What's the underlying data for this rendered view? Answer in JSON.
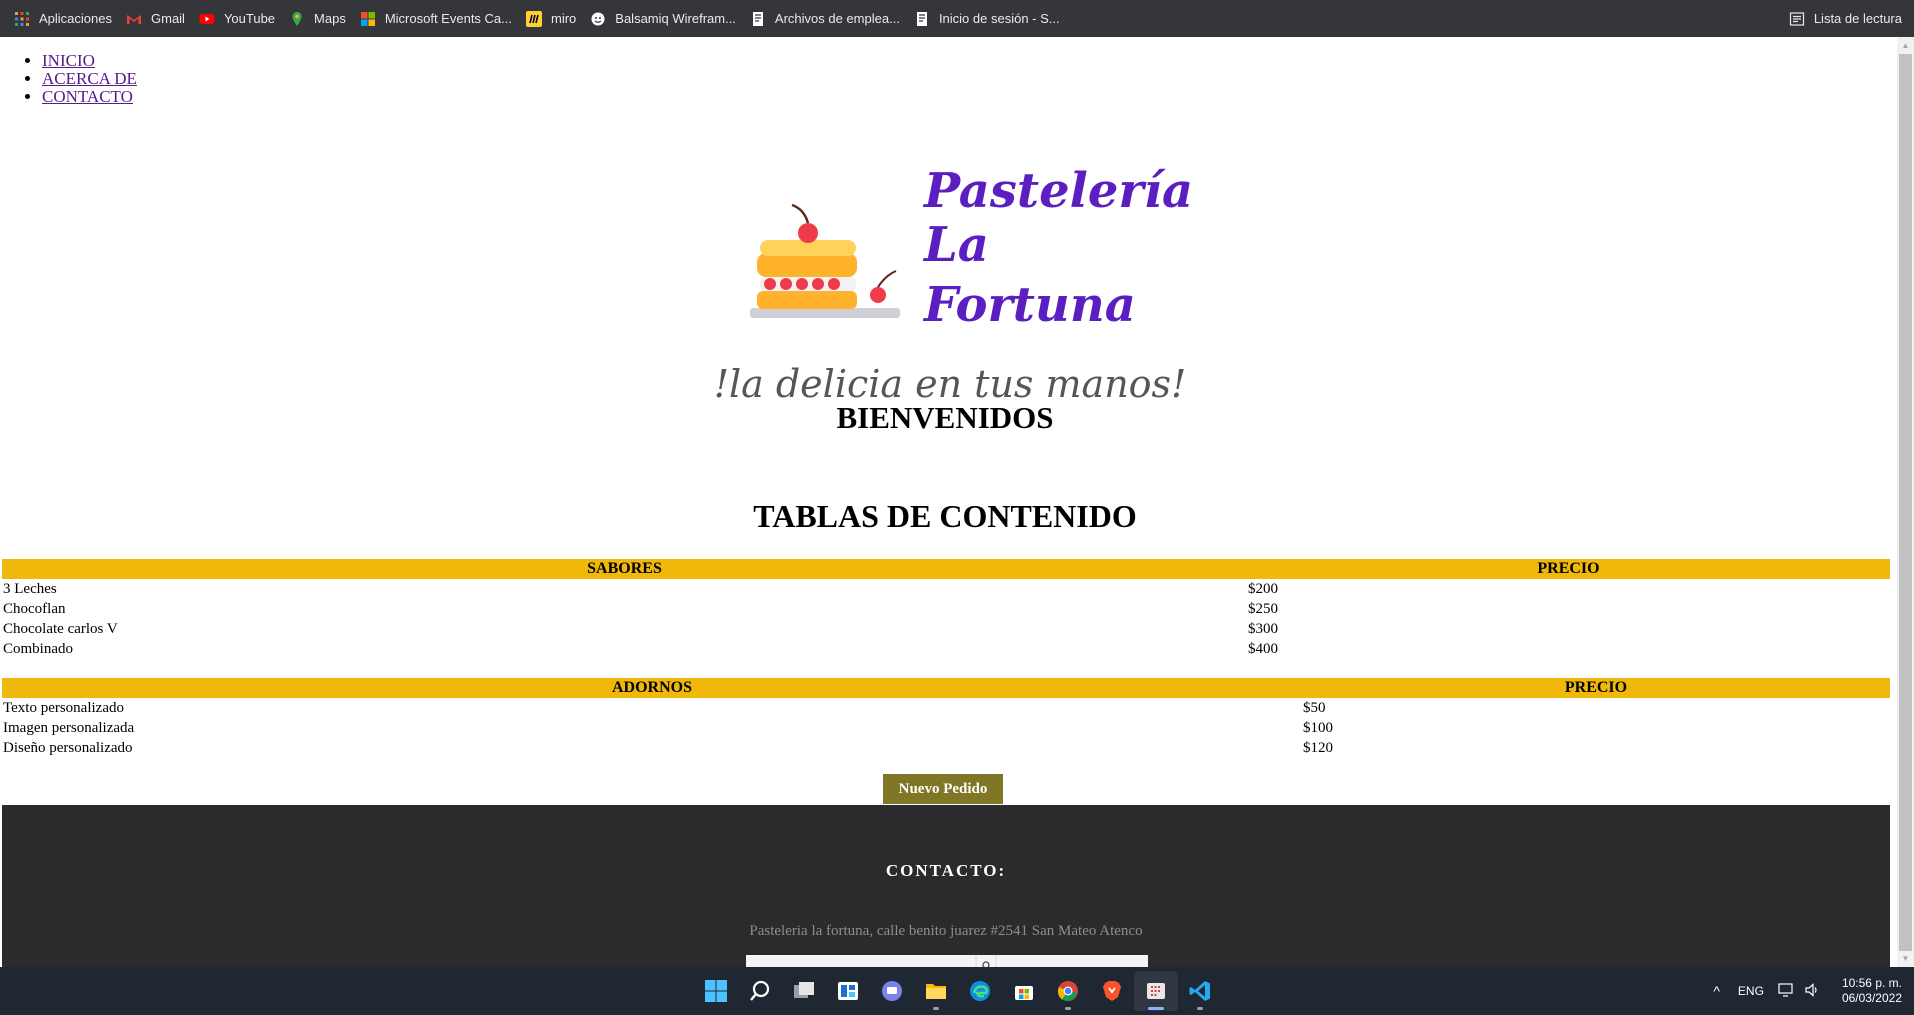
{
  "bookmarks": [
    {
      "label": "Aplicaciones",
      "icon": "apps-grid-icon",
      "color": "#e8a33a"
    },
    {
      "label": "Gmail",
      "icon": "gmail-icon",
      "color": "#ea4335"
    },
    {
      "label": "YouTube",
      "icon": "youtube-icon",
      "color": "#ff0000"
    },
    {
      "label": "Maps",
      "icon": "maps-pin-icon",
      "color": "#34a853"
    },
    {
      "label": "Microsoft Events Ca...",
      "icon": "microsoft-logo-icon",
      "color": "#f25022"
    },
    {
      "label": "miro",
      "icon": "miro-icon",
      "color": "#ffd02f"
    },
    {
      "label": "Balsamiq Wirefram...",
      "icon": "balsamiq-icon",
      "color": "#ffffff"
    },
    {
      "label": "Archivos de emplea...",
      "icon": "document-icon",
      "color": "#ffffff"
    },
    {
      "label": "Inicio de sesión - S...",
      "icon": "document-icon",
      "color": "#ffffff"
    }
  ],
  "reading_list": "Lista de lectura",
  "nav": [
    "INICIO",
    "ACERCA DE",
    "CONTACTO"
  ],
  "logo": {
    "line1": "Pastelería",
    "line2": "La",
    "line3": "Fortuna",
    "tagline": "!la delicia en tus manos!",
    "brand_color": "#5b1fc1"
  },
  "welcome": "BIENVENIDOS",
  "tables_title": "TABLAS DE CONTENIDO",
  "table_flavors": {
    "headers": [
      "SABORES",
      "PRECIO"
    ],
    "rows": [
      [
        "3 Leches",
        "$200"
      ],
      [
        "Chocoflan",
        "$250"
      ],
      [
        "Chocolate carlos V",
        "$300"
      ],
      [
        "Combinado",
        "$400"
      ]
    ]
  },
  "table_toppings": {
    "headers": [
      "ADORNOS",
      "PRECIO"
    ],
    "rows": [
      [
        "Texto personalizado",
        "$50"
      ],
      [
        "Imagen personalizada",
        "$100"
      ],
      [
        "Diseño personalizado",
        "$120"
      ]
    ]
  },
  "order_button": "Nuevo Pedido",
  "footer": {
    "title": "CONTACTO:",
    "address": "Pasteleria la fortuna, calle benito juarez #2541 San Mateo Atenco"
  },
  "taskbar": {
    "apps": [
      "windows-start-icon",
      "search-icon",
      "task-view-icon",
      "widgets-icon",
      "teams-chat-icon",
      "file-explorer-icon",
      "edge-icon",
      "store-icon",
      "chrome-icon",
      "brave-icon",
      "snipping-tool-icon",
      "vscode-icon"
    ],
    "language": "ENG",
    "time": "10:56 p. m.",
    "date": "06/03/2022"
  },
  "colors": {
    "table_header": "#f0b80a",
    "button": "#807726",
    "footer": "#2b2b2e",
    "link": "#551a8b"
  }
}
